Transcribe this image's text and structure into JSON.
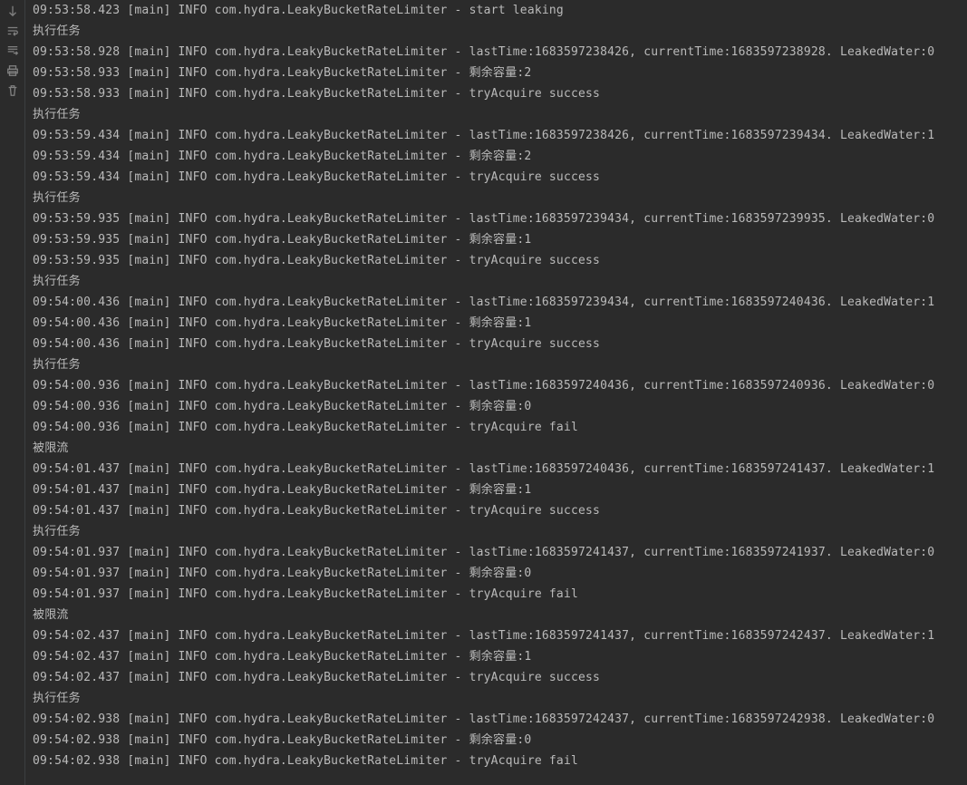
{
  "gutter": {
    "icons": [
      "arrow-down",
      "wrap",
      "scroll-to-end",
      "print",
      "trash"
    ]
  },
  "log_lines": [
    "09:53:58.423 [main] INFO com.hydra.LeakyBucketRateLimiter - start leaking",
    "执行任务",
    "09:53:58.928 [main] INFO com.hydra.LeakyBucketRateLimiter - lastTime:1683597238426, currentTime:1683597238928. LeakedWater:0",
    "09:53:58.933 [main] INFO com.hydra.LeakyBucketRateLimiter - 剩余容量:2",
    "09:53:58.933 [main] INFO com.hydra.LeakyBucketRateLimiter - tryAcquire success",
    "执行任务",
    "09:53:59.434 [main] INFO com.hydra.LeakyBucketRateLimiter - lastTime:1683597238426, currentTime:1683597239434. LeakedWater:1",
    "09:53:59.434 [main] INFO com.hydra.LeakyBucketRateLimiter - 剩余容量:2",
    "09:53:59.434 [main] INFO com.hydra.LeakyBucketRateLimiter - tryAcquire success",
    "执行任务",
    "09:53:59.935 [main] INFO com.hydra.LeakyBucketRateLimiter - lastTime:1683597239434, currentTime:1683597239935. LeakedWater:0",
    "09:53:59.935 [main] INFO com.hydra.LeakyBucketRateLimiter - 剩余容量:1",
    "09:53:59.935 [main] INFO com.hydra.LeakyBucketRateLimiter - tryAcquire success",
    "执行任务",
    "09:54:00.436 [main] INFO com.hydra.LeakyBucketRateLimiter - lastTime:1683597239434, currentTime:1683597240436. LeakedWater:1",
    "09:54:00.436 [main] INFO com.hydra.LeakyBucketRateLimiter - 剩余容量:1",
    "09:54:00.436 [main] INFO com.hydra.LeakyBucketRateLimiter - tryAcquire success",
    "执行任务",
    "09:54:00.936 [main] INFO com.hydra.LeakyBucketRateLimiter - lastTime:1683597240436, currentTime:1683597240936. LeakedWater:0",
    "09:54:00.936 [main] INFO com.hydra.LeakyBucketRateLimiter - 剩余容量:0",
    "09:54:00.936 [main] INFO com.hydra.LeakyBucketRateLimiter - tryAcquire fail",
    "被限流",
    "09:54:01.437 [main] INFO com.hydra.LeakyBucketRateLimiter - lastTime:1683597240436, currentTime:1683597241437. LeakedWater:1",
    "09:54:01.437 [main] INFO com.hydra.LeakyBucketRateLimiter - 剩余容量:1",
    "09:54:01.437 [main] INFO com.hydra.LeakyBucketRateLimiter - tryAcquire success",
    "执行任务",
    "09:54:01.937 [main] INFO com.hydra.LeakyBucketRateLimiter - lastTime:1683597241437, currentTime:1683597241937. LeakedWater:0",
    "09:54:01.937 [main] INFO com.hydra.LeakyBucketRateLimiter - 剩余容量:0",
    "09:54:01.937 [main] INFO com.hydra.LeakyBucketRateLimiter - tryAcquire fail",
    "被限流",
    "09:54:02.437 [main] INFO com.hydra.LeakyBucketRateLimiter - lastTime:1683597241437, currentTime:1683597242437. LeakedWater:1",
    "09:54:02.437 [main] INFO com.hydra.LeakyBucketRateLimiter - 剩余容量:1",
    "09:54:02.437 [main] INFO com.hydra.LeakyBucketRateLimiter - tryAcquire success",
    "执行任务",
    "09:54:02.938 [main] INFO com.hydra.LeakyBucketRateLimiter - lastTime:1683597242437, currentTime:1683597242938. LeakedWater:0",
    "09:54:02.938 [main] INFO com.hydra.LeakyBucketRateLimiter - 剩余容量:0",
    "09:54:02.938 [main] INFO com.hydra.LeakyBucketRateLimiter - tryAcquire fail"
  ]
}
